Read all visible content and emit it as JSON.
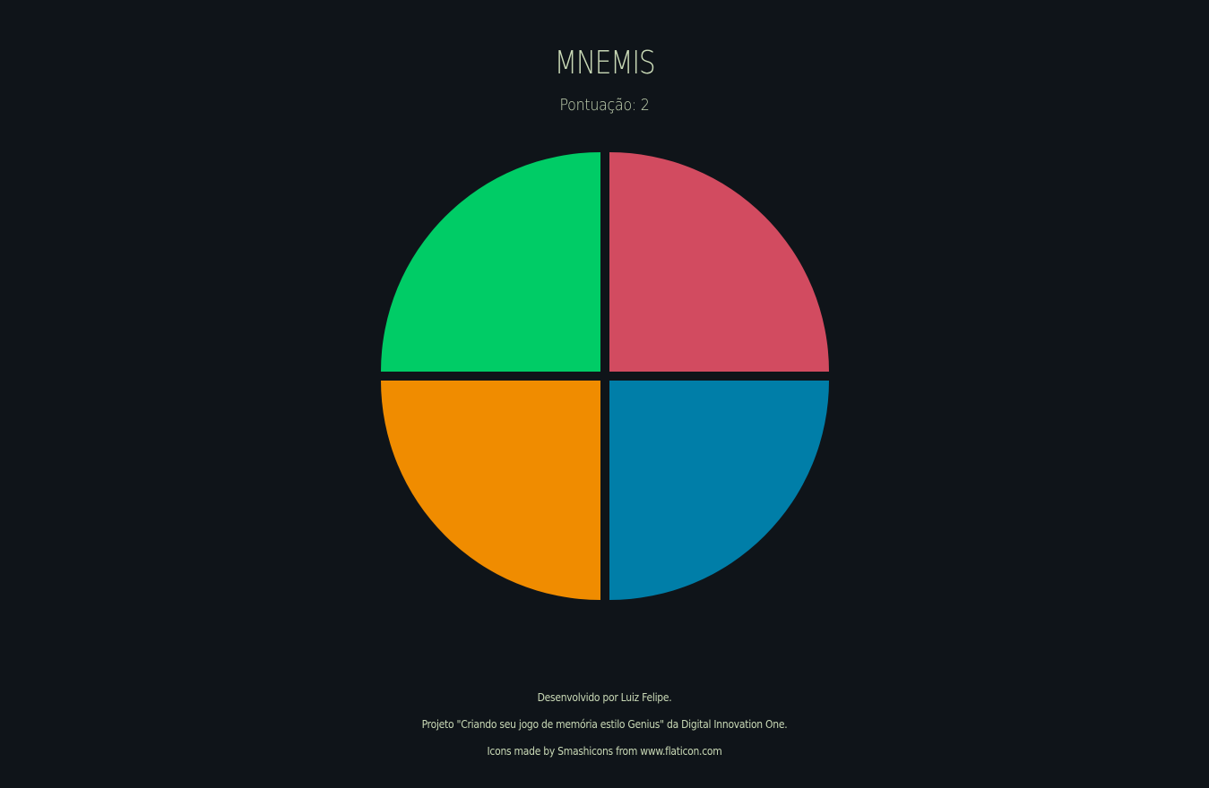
{
  "game": {
    "title": "MNEMIS",
    "score_label": "Pontuação:",
    "score_value": "2"
  },
  "pads": [
    {
      "color_name": "green",
      "color": "#00cc66"
    },
    {
      "color_name": "red",
      "color": "#d24b60"
    },
    {
      "color_name": "orange",
      "color": "#f08c00"
    },
    {
      "color_name": "blue",
      "color": "#007ea8"
    }
  ],
  "footer": {
    "line1": "Desenvolvido por Luiz Felipe.",
    "line2": "Projeto \"Criando seu jogo de memória estilo Genius\" da Digital Innovation One.",
    "line3_prefix": "Icons made by ",
    "line3_author": "Smashicons",
    "line3_mid": " from ",
    "line3_site": "www.flaticon.com"
  },
  "colors": {
    "background": "#0f1419",
    "text": "#c9d9b6"
  }
}
